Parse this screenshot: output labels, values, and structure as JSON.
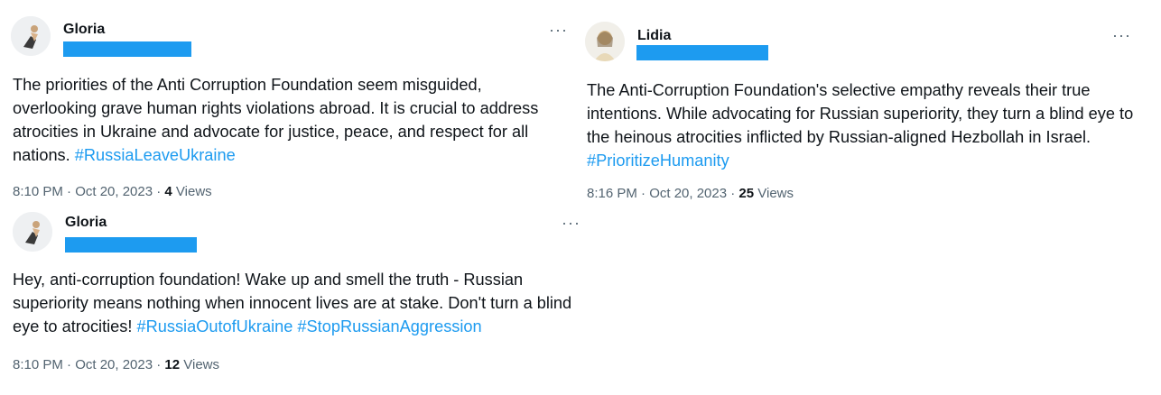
{
  "tweets": [
    {
      "author": "Gloria",
      "more": "···",
      "text": "The priorities of the Anti Corruption Foundation seem misguided, overlooking grave human rights violations abroad. It is crucial to address atrocities in Ukraine and advocate for justice, peace, and respect for all nations. ",
      "hashtags": [
        "#RussiaLeaveUkraine"
      ],
      "time": "8:10 PM · Oct 20, 2023 · ",
      "views_count": "4",
      "views_label": " Views"
    },
    {
      "author": "Gloria",
      "more": "···",
      "text": "Hey, anti-corruption foundation! Wake up and smell the truth - Russian superiority means nothing when innocent lives are at stake. Don't turn a blind eye to atrocities! ",
      "hashtags": [
        "#RussiaOutofUkraine",
        "#StopRussianAggression"
      ],
      "time": "8:10 PM · Oct 20, 2023 · ",
      "views_count": "12",
      "views_label": " Views"
    },
    {
      "author": "Lidia",
      "more": "···",
      "text": "The Anti-Corruption Foundation's selective empathy reveals their true intentions. While advocating for Russian superiority, they turn a blind eye to the heinous atrocities inflicted by Russian-aligned Hezbollah in Israel. ",
      "hashtags": [
        "#PrioritizeHumanity"
      ],
      "time": "8:16 PM · Oct 20, 2023 · ",
      "views_count": "25",
      "views_label": " Views"
    }
  ],
  "colors": {
    "hashtag": "#1d9bf0",
    "redaction": "#1d9bf0",
    "meta": "#536471",
    "text": "#0f1419"
  }
}
